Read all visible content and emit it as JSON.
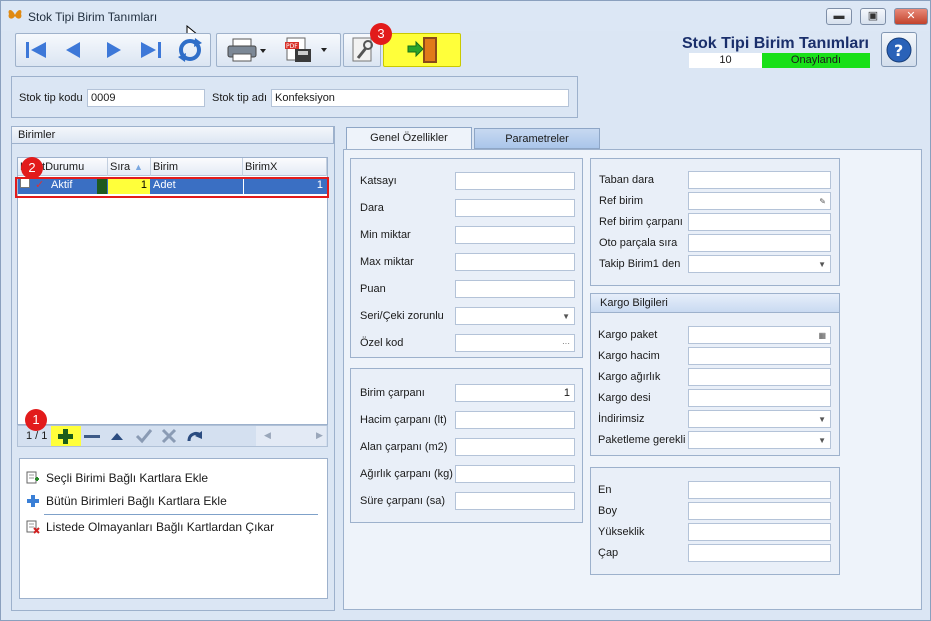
{
  "window": {
    "title": "Stok Tipi Birim Tanımları"
  },
  "header": {
    "title": "Stok Tipi Birim Tanımları",
    "record_count": "10",
    "status": "Onaylandı",
    "status_color": "#18e018"
  },
  "annotations": [
    "1",
    "2",
    "3"
  ],
  "toolbar": {
    "buttons": [
      "first-record-icon",
      "prev-record-icon",
      "next-record-icon",
      "last-record-icon",
      "refresh-icon",
      "print-icon",
      "pdf-export-icon",
      "settings-wrench-icon",
      "exit-door-icon"
    ]
  },
  "stok": {
    "kod_label": "Stok tip kodu",
    "kod_value": "0009",
    "ad_label": "Stok tip adı",
    "ad_value": "Konfeksiyon"
  },
  "birimler": {
    "title": "Birimler",
    "columns": [
      "KayıtDurumu",
      "Sıra",
      "Birim",
      "BirimX"
    ],
    "rows": [
      {
        "durum": "Aktif",
        "sira": "1",
        "birim": "Adet",
        "birimx": "1"
      }
    ],
    "nav_text": "1 / 1"
  },
  "actions": [
    "Seçli Birimi Bağlı Kartlara Ekle",
    "Bütün Birimleri Bağlı Kartlara Ekle",
    "Listede Olmayanları Bağlı Kartlardan Çıkar"
  ],
  "tabs": [
    "Genel Özellikler",
    "Parametreler"
  ],
  "genel": {
    "fields": [
      {
        "label": "Katsayı",
        "value": ""
      },
      {
        "label": "Dara",
        "value": ""
      },
      {
        "label": "Min miktar",
        "value": ""
      },
      {
        "label": "Max miktar",
        "value": ""
      },
      {
        "label": "Puan",
        "value": ""
      },
      {
        "label": "Seri/Çeki zorunlu",
        "value": ""
      },
      {
        "label": "Özel kod",
        "value": ""
      }
    ],
    "carpan": [
      {
        "label": "Birim çarpanı",
        "value": "1"
      },
      {
        "label": "Hacim çarpanı (lt)",
        "value": ""
      },
      {
        "label": "Alan çarpanı (m2)",
        "value": ""
      },
      {
        "label": "Ağırlık çarpanı (kg)",
        "value": ""
      },
      {
        "label": "Süre çarpanı (sa)",
        "value": ""
      }
    ],
    "right": [
      {
        "label": "Taban dara",
        "value": ""
      },
      {
        "label": "Ref birim",
        "value": ""
      },
      {
        "label": "Ref birim çarpanı",
        "value": ""
      },
      {
        "label": "Oto parçala sıra",
        "value": ""
      },
      {
        "label": "Takip Birim1 den",
        "value": ""
      }
    ],
    "kargo_title": "Kargo Bilgileri",
    "kargo": [
      {
        "label": "Kargo paket",
        "value": ""
      },
      {
        "label": "Kargo hacim",
        "value": ""
      },
      {
        "label": "Kargo ağırlık",
        "value": ""
      },
      {
        "label": "Kargo desi",
        "value": ""
      },
      {
        "label": "İndirimsiz",
        "value": ""
      },
      {
        "label": "Paketleme gerekli",
        "value": ""
      }
    ],
    "olcu": [
      {
        "label": "En",
        "value": ""
      },
      {
        "label": "Boy",
        "value": ""
      },
      {
        "label": "Yükseklik",
        "value": ""
      },
      {
        "label": "Çap",
        "value": ""
      }
    ]
  }
}
